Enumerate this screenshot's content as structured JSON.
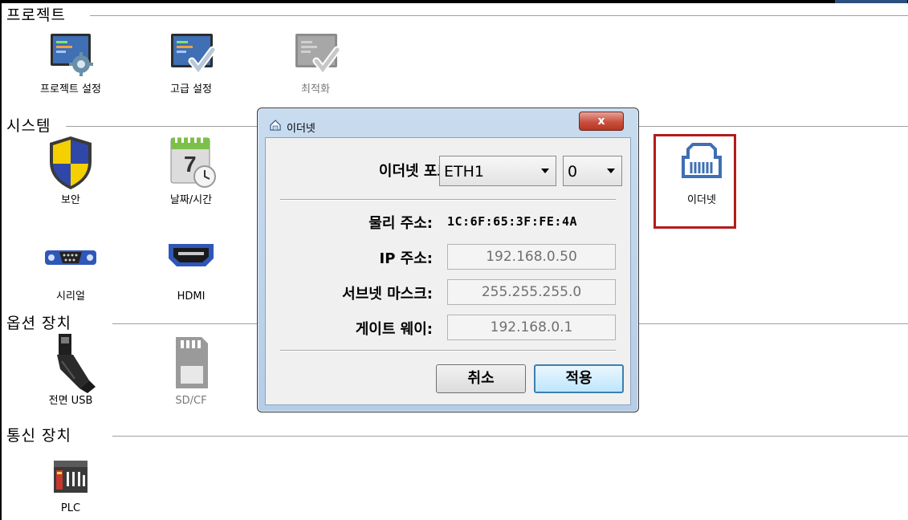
{
  "sections": {
    "project": "프로젝트",
    "system": "시스템",
    "options": "옵션 장치",
    "comm": "통신 장치"
  },
  "tiles": {
    "project_settings": "프로젝트 설정",
    "advanced_settings": "고급 설정",
    "optimize": "최적화",
    "security": "보안",
    "datetime": "날짜/시간",
    "serial": "시리얼",
    "hdmi": "HDMI",
    "ethernet": "이더넷",
    "front_usb": "전면 USB",
    "sdcf": "SD/CF",
    "plc": "PLC"
  },
  "dialog": {
    "title": "이더넷",
    "close_glyph": "x",
    "port_label": "이더넷 포트",
    "port_value": "ETH1",
    "port_index": "0",
    "mac_label": "물리 주소:",
    "mac_value": "1C:6F:65:3F:FE:4A",
    "ip_label": "IP 주소:",
    "ip_value": "192.168.0.50",
    "mask_label": "서브넷 마스크:",
    "mask_value": "255.255.255.0",
    "gw_label": "게이트 웨이:",
    "gw_value": "192.168.0.1",
    "cancel": "취소",
    "apply": "적용"
  },
  "colors": {
    "highlight": "#b31b1b",
    "monitor_blue": "#3f6fb4",
    "check_gray": "#a7a7a7"
  }
}
